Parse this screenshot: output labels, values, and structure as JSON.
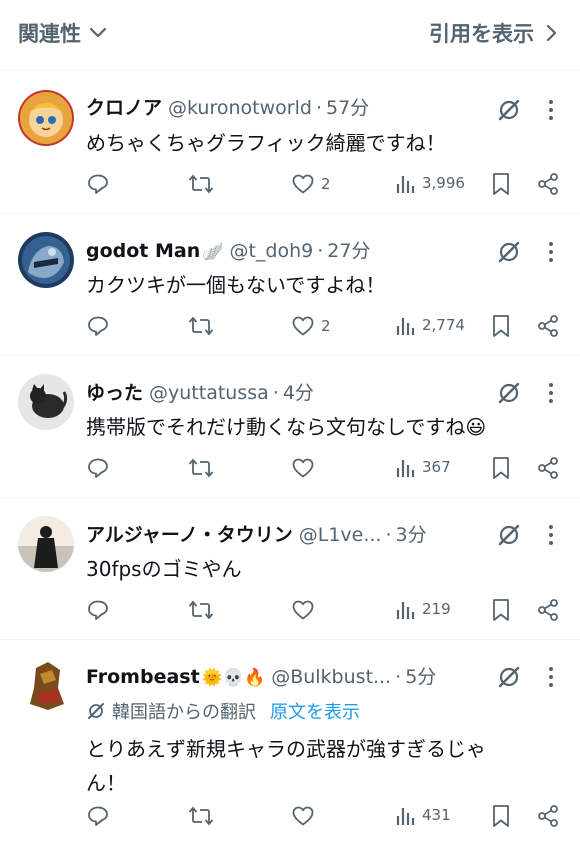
{
  "top": {
    "sort_label": "関連性",
    "quotes_label": "引用を表示"
  },
  "posts": [
    {
      "name": "クロノア",
      "handle": "@kuronotworld",
      "time": "57分",
      "text": "めちゃくちゃグラフィック綺麗ですね！",
      "likes": "2",
      "views": "3,996"
    },
    {
      "name": "godot Man",
      "name_suffix": "🪽",
      "handle": "@t_doh9",
      "time": "27分",
      "text": "カクツキが一個もないですよね！",
      "likes": "2",
      "views": "2,774"
    },
    {
      "name": "ゆった",
      "handle": "@yuttatussa",
      "time": "4分",
      "text": "携帯版でそれだけ動くなら文句なしですね😃",
      "likes": "",
      "views": "367"
    },
    {
      "name": "アルジャーノ・タウリン",
      "handle": "@L1ve...",
      "time": "3分",
      "text": "30fpsのゴミやん",
      "likes": "",
      "views": "219"
    },
    {
      "name": "Frombeast",
      "name_suffix": "🌞💀🔥",
      "handle": "@Bulkbust...",
      "time": "5分",
      "translation_note": "韓国語からの翻訳",
      "show_original": "原文を表示",
      "text_line1": "とりあえず新規キャラの武器が強すぎるじゃ",
      "text_line2": "ん！",
      "likes": "",
      "views": "431"
    }
  ],
  "separator": "·"
}
